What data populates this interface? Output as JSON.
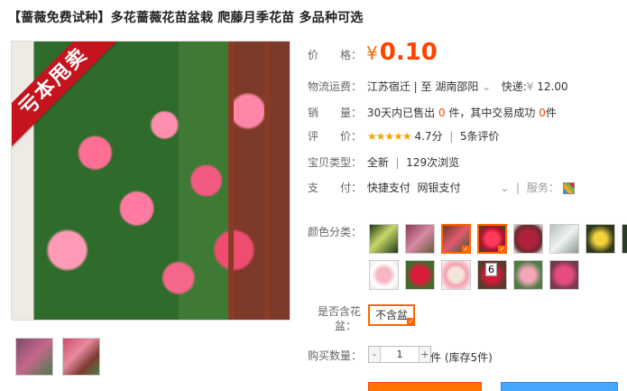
{
  "title": "【蔷薇免费试种】多花蔷薇花苗盆栽 爬藤月季花苗 多品种可选",
  "photo": {
    "ribbon": "亏本甩卖"
  },
  "price": {
    "label": "价　　格：",
    "currency": "¥",
    "value": "0.10"
  },
  "shipping": {
    "label": "物流运费：",
    "from": "江苏宿迁",
    "sep": "| 至",
    "to": "湖南邵阳",
    "dropdown": "⌄",
    "method": "快递:",
    "currency": "¥",
    "fee": "12.00"
  },
  "sales": {
    "label": "销　　量：",
    "prefix": "30天内已售出",
    "sold": "0",
    "mid": "件，其中交易成功",
    "success": "0",
    "suffix": "件"
  },
  "rating": {
    "label": "评　　价：",
    "stars": "★★★★★",
    "score": "4.7分",
    "sep": "|",
    "count": "5条评价"
  },
  "condition": {
    "label": "宝贝类型：",
    "value": "全新",
    "sep": "|",
    "views": "129次浏览"
  },
  "payment": {
    "label": "支　　付：",
    "method1": "快捷支付",
    "method2": "网银支付",
    "arrow": "⌄",
    "service_label": "服务："
  },
  "color": {
    "label": "颜色分类：",
    "badge": "6"
  },
  "pot": {
    "label_line1": "是否含花",
    "label_line2": "盆：",
    "option": "不含盆"
  },
  "quantity": {
    "label": "购买数量：",
    "minus": "-",
    "value": "1",
    "plus": "+",
    "unit": "件",
    "stock": "(库存5件)"
  },
  "colors": {
    "accent": "#ff4400",
    "selected_border": "#ff6600",
    "star": "#f9a400"
  }
}
